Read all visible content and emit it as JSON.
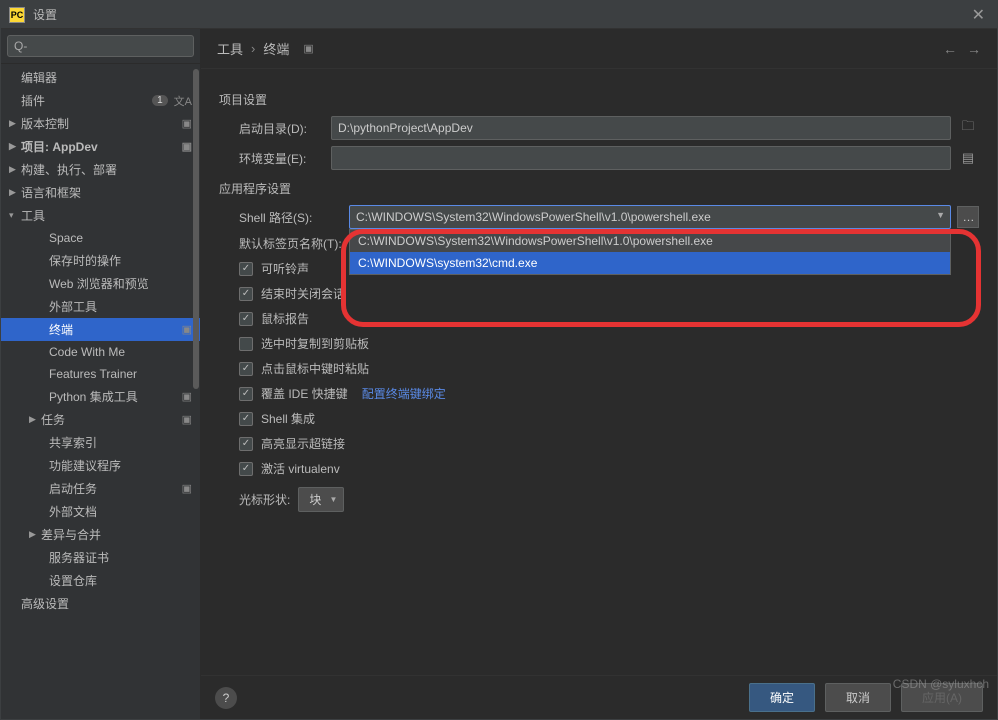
{
  "window": {
    "title": "设置"
  },
  "search": {
    "placeholder": "Q-"
  },
  "breadcrumb": {
    "part1": "工具",
    "part2": "终端"
  },
  "sidebar": {
    "items": [
      {
        "label": "编辑器"
      },
      {
        "label": "插件",
        "badge": "1"
      },
      {
        "label": "版本控制"
      },
      {
        "label": "项目: AppDev"
      },
      {
        "label": "构建、执行、部署"
      },
      {
        "label": "语言和框架"
      },
      {
        "label": "工具"
      },
      {
        "label": "Space"
      },
      {
        "label": "保存时的操作"
      },
      {
        "label": "Web 浏览器和预览"
      },
      {
        "label": "外部工具"
      },
      {
        "label": "终端"
      },
      {
        "label": "Code With Me"
      },
      {
        "label": "Features Trainer"
      },
      {
        "label": "Python 集成工具"
      },
      {
        "label": "任务"
      },
      {
        "label": "共享索引"
      },
      {
        "label": "功能建议程序"
      },
      {
        "label": "启动任务"
      },
      {
        "label": "外部文档"
      },
      {
        "label": "差异与合并"
      },
      {
        "label": "服务器证书"
      },
      {
        "label": "设置仓库"
      },
      {
        "label": "高级设置"
      }
    ]
  },
  "section": {
    "project": "项目设置",
    "app": "应用程序设置"
  },
  "fields": {
    "startDir": {
      "label": "启动目录(D):",
      "value": "D:\\pythonProject\\AppDev"
    },
    "envVars": {
      "label": "环境变量(E):",
      "value": ""
    },
    "shellPath": {
      "label": "Shell 路径(S):",
      "value": "C:\\WINDOWS\\System32\\WindowsPowerShell\\v1.0\\powershell.exe"
    },
    "tabName": {
      "label": "默认标签页名称(T):"
    },
    "cursor": {
      "label": "光标形状:",
      "value": "块"
    }
  },
  "dropdown": {
    "opt0": "C:\\WINDOWS\\System32\\WindowsPowerShell\\v1.0\\powershell.exe",
    "opt1": "C:\\WINDOWS\\system32\\cmd.exe"
  },
  "checkboxes": {
    "bell": "可听铃声",
    "closeSession": "结束时关闭会话",
    "mouseReport": "鼠标报告",
    "copyOnSelect": "选中时复制到剪贴板",
    "middlePaste": "点击鼠标中键时粘贴",
    "overrideIde": "覆盖 IDE 快捷键",
    "shellIntegration": "Shell 集成",
    "highlightLinks": "高亮显示超链接",
    "activateVenv": "激活 virtualenv"
  },
  "link": {
    "configureBindings": "配置终端键绑定"
  },
  "buttons": {
    "ok": "确定",
    "cancel": "取消",
    "apply": "应用(A)"
  },
  "watermark": "CSDN @syluxhch"
}
